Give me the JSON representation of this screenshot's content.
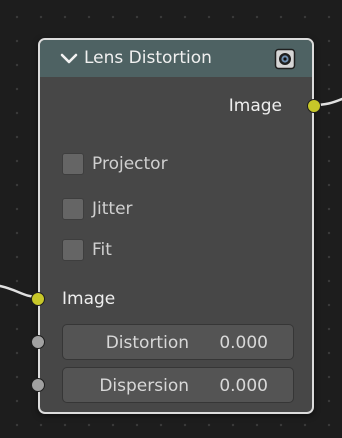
{
  "node": {
    "title": "Lens Distortion",
    "outputs": [
      {
        "label": "Image",
        "socket_type": "color",
        "connected": true
      }
    ],
    "options": [
      {
        "label": "Projector",
        "checked": false
      },
      {
        "label": "Jitter",
        "checked": false
      },
      {
        "label": "Fit",
        "checked": false
      }
    ],
    "inputs": [
      {
        "label": "Image",
        "socket_type": "color",
        "connected": true
      },
      {
        "label": "Distortion",
        "value": "0.000",
        "socket_type": "value",
        "connected": false
      },
      {
        "label": "Dispersion",
        "value": "0.000",
        "socket_type": "value",
        "connected": false
      }
    ]
  },
  "icons": {
    "collapse": "chevron-down-icon",
    "preview": "preview-eye-icon"
  },
  "colors": {
    "canvas_bg": "#1d1d1d",
    "grid_dot": "#3a3a3a",
    "node_body": "#474747",
    "node_header": "#4e6263",
    "node_border": "#dcdcdc",
    "image_socket": "#c7c729",
    "value_socket": "#a1a1a1",
    "wire": "#e0e0e0"
  }
}
